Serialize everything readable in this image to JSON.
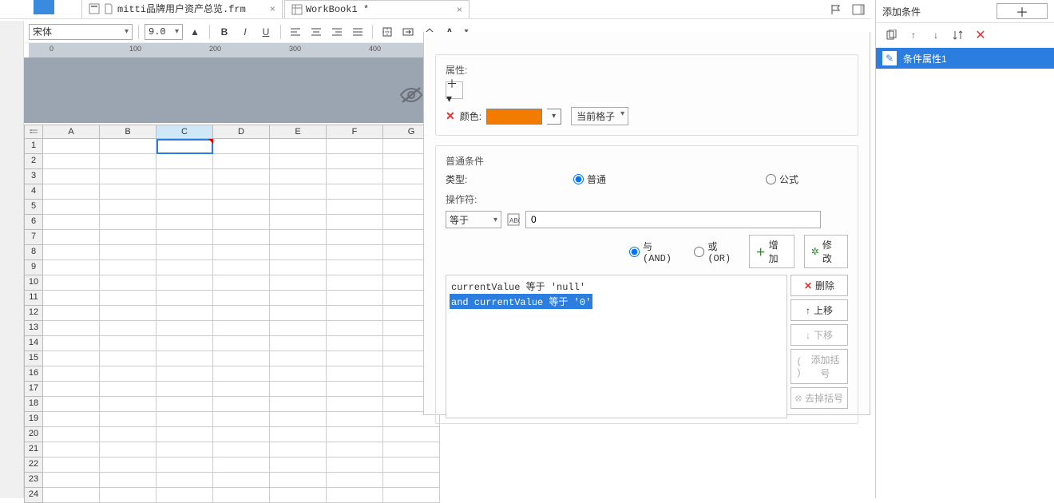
{
  "tabs": [
    {
      "label": "mitti品牌用户资产总览.frm",
      "tooltip": "mitti品牌用户资产总览.frm"
    },
    {
      "label": "WorkBook1 *",
      "tooltip": "WorkBook1 *"
    }
  ],
  "toolbar": {
    "font_name": "宋体",
    "font_size": "9.0"
  },
  "ruler": {
    "ticks": [
      "0",
      "100",
      "200",
      "300",
      "400"
    ]
  },
  "columns": [
    "A",
    "B",
    "C",
    "D",
    "E",
    "F",
    "G"
  ],
  "row_numbers": [
    1,
    2,
    3,
    4,
    5,
    6,
    7,
    8,
    9,
    10,
    11,
    12,
    13,
    14,
    15,
    16,
    17,
    18,
    19,
    20,
    21,
    22,
    23,
    24
  ],
  "selected_cell": {
    "col": "C",
    "row": 1
  },
  "dialog": {
    "title": "条件属性1",
    "attr_label": "属性:",
    "color_label": "颜色:",
    "color_hex": "#f37b00",
    "scope_label": "当前格子",
    "cond_section_title": "普通条件",
    "type_label": "类型:",
    "type_opts": {
      "normal": "普通",
      "formula": "公式"
    },
    "type_selected": "normal",
    "operator_label": "操作符:",
    "operator_value": "等于",
    "value_input": "0",
    "logic": {
      "and": "与(AND)",
      "or": "或(OR)",
      "selected": "and"
    },
    "add_btn": "增加",
    "modify_btn": "修改",
    "clauses": [
      {
        "text": "currentValue 等于 'null'",
        "selected": false
      },
      {
        "text": "and currentValue 等于 '0'",
        "selected": true
      }
    ],
    "side_buttons": {
      "delete": "删除",
      "up": "上移",
      "down": "下移",
      "add_paren": "添加括号",
      "rm_paren": "去掉括号"
    }
  },
  "right_panel": {
    "header": "添加条件",
    "item_label": "条件属性1"
  }
}
